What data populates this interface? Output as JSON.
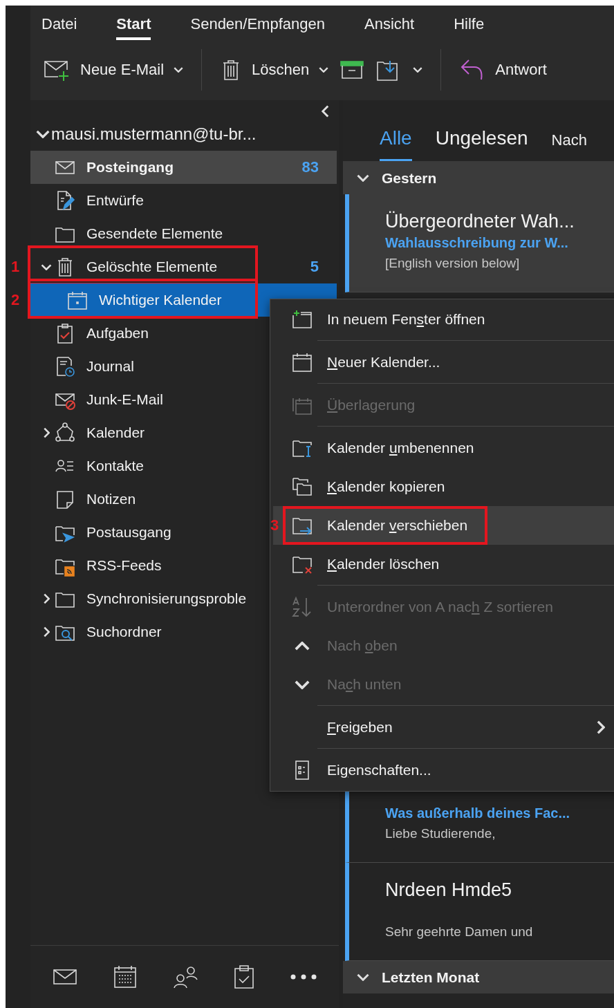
{
  "ribbon": {
    "tabs": [
      {
        "label": "Datei",
        "selected": false
      },
      {
        "label": "Start",
        "selected": true
      },
      {
        "label": "Senden/Empfangen",
        "selected": false
      },
      {
        "label": "Ansicht",
        "selected": false
      },
      {
        "label": "Hilfe",
        "selected": false
      }
    ],
    "toolbar": [
      {
        "kind": "new-mail",
        "label": "Neue E-Mail",
        "dropdown": true
      },
      {
        "kind": "separator"
      },
      {
        "kind": "delete",
        "label": "Löschen",
        "dropdown": true
      },
      {
        "kind": "archive",
        "dropdown": false
      },
      {
        "kind": "move",
        "dropdown": true
      },
      {
        "kind": "separator"
      },
      {
        "kind": "reply",
        "label": "Antwort",
        "dropdown": false
      }
    ]
  },
  "folder_pane": {
    "account": {
      "label": "mausi.mustermann@tu-br...",
      "expanded": true
    },
    "folders": [
      {
        "label": "Posteingang",
        "kind": "inbox",
        "count": "83",
        "current": true,
        "selected": false
      },
      {
        "label": "Entwürfe",
        "kind": "drafts",
        "current": false,
        "selected": false
      },
      {
        "label": "Gesendete Elemente",
        "kind": "sent",
        "current": false,
        "selected": false
      },
      {
        "label": "Gelöschte Elemente",
        "kind": "deleted",
        "count": "5",
        "current": false,
        "selected": false,
        "expanded": true,
        "annotation": "1",
        "children": [
          {
            "label": "Wichtiger Kalender",
            "kind": "calendar",
            "current": false,
            "selected": true,
            "annotation": "2"
          }
        ]
      },
      {
        "label": "Aufgaben",
        "kind": "tasks",
        "current": false,
        "selected": false
      },
      {
        "label": "Journal",
        "kind": "journal",
        "current": false,
        "selected": false
      },
      {
        "label": "Junk-E-Mail",
        "kind": "junk",
        "current": false,
        "selected": false
      },
      {
        "label": "Kalender",
        "kind": "calendars",
        "current": false,
        "selected": false,
        "expanded": false
      },
      {
        "label": "Kontakte",
        "kind": "contacts",
        "current": false,
        "selected": false
      },
      {
        "label": "Notizen",
        "kind": "notes",
        "current": false,
        "selected": false
      },
      {
        "label": "Postausgang",
        "kind": "outbox",
        "current": false,
        "selected": false
      },
      {
        "label": "RSS-Feeds",
        "kind": "rss",
        "current": false,
        "selected": false
      },
      {
        "label": "Synchronisierungsproble",
        "kind": "folder",
        "current": false,
        "selected": false,
        "expanded": false
      },
      {
        "label": "Suchordner",
        "kind": "search-folder",
        "current": false,
        "selected": false,
        "expanded": false
      }
    ]
  },
  "mail_list": {
    "tabs": [
      {
        "label": "Alle",
        "selected": true
      },
      {
        "label": "Ungelesen",
        "selected": false
      },
      {
        "label": "Nach",
        "selected": false
      }
    ],
    "groups": [
      {
        "label": "Gestern",
        "expanded": true,
        "messages": [
          {
            "sender": "Übergeordneter Wah...",
            "subject": "Wahlausschreibung zur W...",
            "preview": "[English version below]",
            "unread": true,
            "selected": true
          },
          {
            "subject": "Was außerhalb deines Fac...",
            "preview": "Liebe Studierende,",
            "unread": true,
            "selected": false
          },
          {
            "sender": "Nrdeen Hmde5",
            "preview": "Sehr geehrte Damen und",
            "unread": true,
            "selected": false
          }
        ]
      },
      {
        "label": "Letzten Monat",
        "expanded": true
      }
    ]
  },
  "context_menu": {
    "groups": [
      [
        {
          "kind": "new-window",
          "label": [
            {
              "text": "In neuem Fen"
            },
            {
              "text": "s",
              "underline": true
            },
            {
              "text": "ter öffnen"
            }
          ],
          "disabled": false,
          "highlighted": false,
          "submenu": false
        }
      ],
      [
        {
          "kind": "new-calendar",
          "label": [
            {
              "text": "N",
              "underline": true
            },
            {
              "text": "euer Kalender..."
            }
          ],
          "disabled": false,
          "highlighted": false,
          "submenu": false
        }
      ],
      [
        {
          "kind": "overlay",
          "label": [
            {
              "text": "Ü",
              "underline": true
            },
            {
              "text": "berlagerung"
            }
          ],
          "disabled": true,
          "highlighted": false,
          "submenu": false
        }
      ],
      [
        {
          "kind": "rename",
          "label": [
            {
              "text": "Kalender "
            },
            {
              "text": "u",
              "underline": true
            },
            {
              "text": "mbenennen"
            }
          ],
          "disabled": false,
          "highlighted": false,
          "submenu": false
        },
        {
          "kind": "copy",
          "label": [
            {
              "text": "K",
              "underline": true
            },
            {
              "text": "alender kopieren"
            }
          ],
          "disabled": false,
          "highlighted": false,
          "submenu": false
        },
        {
          "kind": "move",
          "label": [
            {
              "text": "Kalender "
            },
            {
              "text": "v",
              "underline": true
            },
            {
              "text": "erschieben"
            }
          ],
          "disabled": false,
          "highlighted": true,
          "submenu": false,
          "annotation": "3"
        },
        {
          "kind": "delete",
          "label": [
            {
              "text": "K",
              "underline": true
            },
            {
              "text": "alender löschen"
            }
          ],
          "disabled": false,
          "highlighted": false,
          "submenu": false
        }
      ],
      [
        {
          "kind": "sort",
          "label": [
            {
              "text": "Unterordner von A nac"
            },
            {
              "text": "h",
              "underline": true
            },
            {
              "text": " Z sortieren"
            }
          ],
          "disabled": true,
          "highlighted": false,
          "submenu": false
        },
        {
          "kind": "up",
          "label": [
            {
              "text": "Nach "
            },
            {
              "text": "o",
              "underline": true
            },
            {
              "text": "ben"
            }
          ],
          "disabled": true,
          "highlighted": false,
          "submenu": false
        },
        {
          "kind": "down",
          "label": [
            {
              "text": "Na"
            },
            {
              "text": "c",
              "underline": true
            },
            {
              "text": "h unten"
            }
          ],
          "disabled": true,
          "highlighted": false,
          "submenu": false
        }
      ],
      [
        {
          "kind": "plain",
          "label": [
            {
              "text": "F",
              "underline": true
            },
            {
              "text": "reigeben"
            }
          ],
          "disabled": false,
          "highlighted": false,
          "submenu": true
        }
      ],
      [
        {
          "kind": "properties",
          "label": [
            {
              "text": "Ei"
            },
            {
              "text": "g",
              "underline": true
            },
            {
              "text": "enschaften..."
            }
          ],
          "disabled": false,
          "highlighted": false,
          "submenu": false
        }
      ]
    ]
  }
}
